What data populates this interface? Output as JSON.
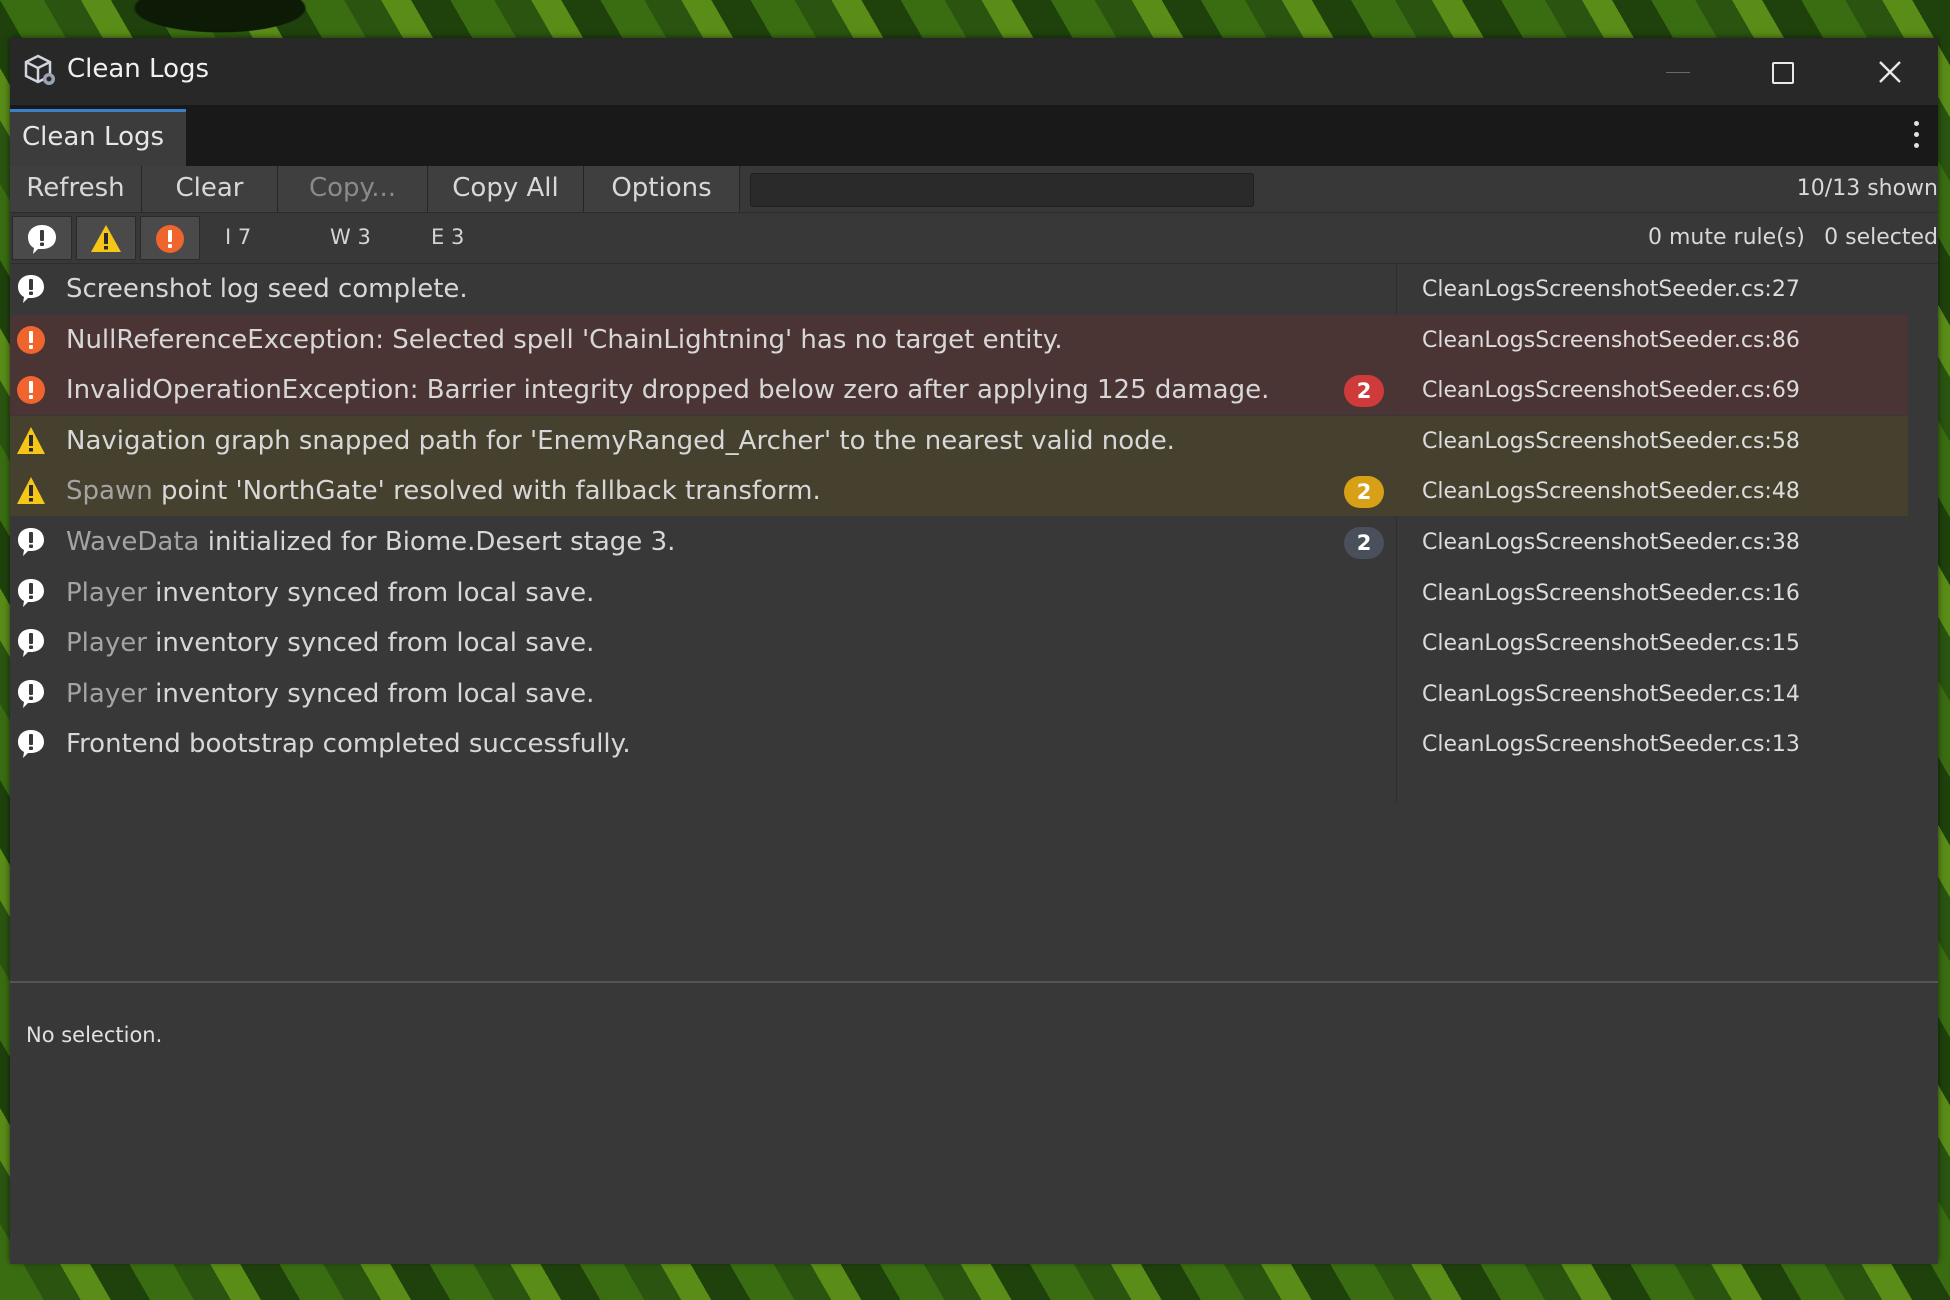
{
  "colors": {
    "accent": "#3a7fc9",
    "error": "#f0642d",
    "warning": "#f5c518",
    "info": "#ffffff",
    "badge_error": "#cf3b3b",
    "badge_warning": "#d7a016",
    "badge_info": "#4a4f5c"
  },
  "window": {
    "title": "Clean Logs",
    "icon": "unity-cube-icon",
    "controls": [
      "minimize-icon",
      "maximize-icon",
      "close-icon"
    ]
  },
  "tab": {
    "label": "Clean Logs",
    "menu_icon": "kebab-menu-icon"
  },
  "toolbar": {
    "refresh": "Refresh",
    "clear": "Clear",
    "copy": "Copy...",
    "copy_all": "Copy All",
    "options": "Options",
    "search_value": "",
    "shown": "10/13 shown"
  },
  "filters": {
    "info_count": "I 7",
    "warning_count": "W 3",
    "error_count": "E 3",
    "mute_rules": "0 mute rule(s)",
    "selected": "0 selected"
  },
  "logs": [
    {
      "level": "info",
      "icon": "info-icon",
      "highlight": "",
      "message": "Screenshot log seed complete.",
      "badge": "",
      "source": "CleanLogsScreenshotSeeder.cs:27"
    },
    {
      "level": "error",
      "icon": "error-icon",
      "highlight": "",
      "message": "NullReferenceException: Selected spell 'ChainLightning' has no target entity.",
      "badge": "",
      "source": "CleanLogsScreenshotSeeder.cs:86"
    },
    {
      "level": "error",
      "icon": "error-icon",
      "highlight": "",
      "message": "InvalidOperationException: Barrier integrity dropped below zero after applying 125 damage.",
      "badge": "2",
      "source": "CleanLogsScreenshotSeeder.cs:69"
    },
    {
      "level": "warning",
      "icon": "warning-icon",
      "highlight": "",
      "message": "Navigation graph snapped path for 'EnemyRanged_Archer' to the nearest valid node.",
      "badge": "",
      "source": "CleanLogsScreenshotSeeder.cs:58"
    },
    {
      "level": "warning",
      "icon": "warning-icon",
      "highlight": "Spawn",
      "message": " point 'NorthGate' resolved with fallback transform.",
      "badge": "2",
      "source": "CleanLogsScreenshotSeeder.cs:48"
    },
    {
      "level": "info",
      "icon": "info-icon",
      "highlight": "WaveData",
      "message": " initialized for Biome.Desert stage 3.",
      "badge": "2",
      "source": "CleanLogsScreenshotSeeder.cs:38"
    },
    {
      "level": "info",
      "icon": "info-icon",
      "highlight": "Player",
      "message": " inventory synced from local save.",
      "badge": "",
      "source": "CleanLogsScreenshotSeeder.cs:16"
    },
    {
      "level": "info",
      "icon": "info-icon",
      "highlight": "Player",
      "message": " inventory synced from local save.",
      "badge": "",
      "source": "CleanLogsScreenshotSeeder.cs:15"
    },
    {
      "level": "info",
      "icon": "info-icon",
      "highlight": "Player",
      "message": " inventory synced from local save.",
      "badge": "",
      "source": "CleanLogsScreenshotSeeder.cs:14"
    },
    {
      "level": "info",
      "icon": "info-icon",
      "highlight": "",
      "message": "Frontend bootstrap completed successfully.",
      "badge": "",
      "source": "CleanLogsScreenshotSeeder.cs:13"
    }
  ],
  "detail": {
    "text": "No selection."
  }
}
